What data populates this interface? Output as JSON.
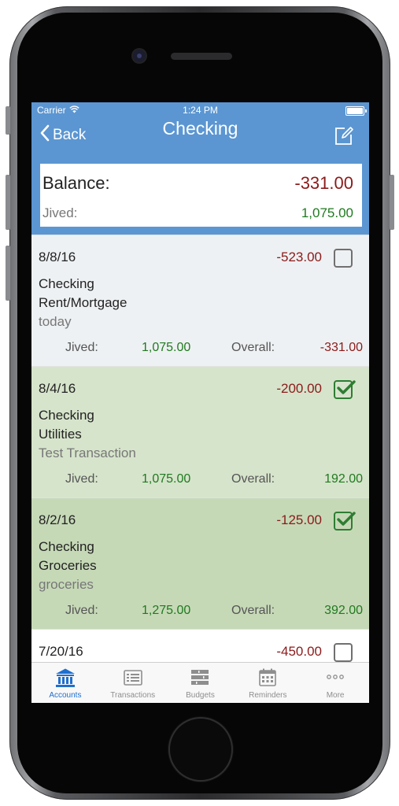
{
  "status_bar": {
    "carrier": "Carrier",
    "time": "1:24 PM"
  },
  "nav": {
    "back_label": "Back",
    "title": "Checking"
  },
  "balance": {
    "label": "Balance:",
    "value": "-331.00",
    "jived_label": "Jived:",
    "jived_value": "1,075.00"
  },
  "transactions": [
    {
      "date": "8/8/16",
      "amount": "-523.00",
      "checked": false,
      "account": "Checking",
      "category": "Rent/Mortgage",
      "memo": "today",
      "jived_label": "Jived:",
      "jived": "1,075.00",
      "overall_label": "Overall:",
      "overall": "-331.00",
      "bg": "#eef1f3",
      "overall_color": "#8b1a1a"
    },
    {
      "date": "8/4/16",
      "amount": "-200.00",
      "checked": true,
      "account": "Checking",
      "category": "Utilities",
      "memo": "Test Transaction",
      "jived_label": "Jived:",
      "jived": "1,075.00",
      "overall_label": "Overall:",
      "overall": "192.00",
      "bg": "#d6e4cb",
      "overall_color": "#1f7a1f"
    },
    {
      "date": "8/2/16",
      "amount": "-125.00",
      "checked": true,
      "account": "Checking",
      "category": "Groceries",
      "memo": "groceries",
      "jived_label": "Jived:",
      "jived": "1,275.00",
      "overall_label": "Overall:",
      "overall": "392.00",
      "bg": "#c6d9b7",
      "overall_color": "#1f7a1f"
    },
    {
      "date": "7/20/16",
      "amount": "-450.00",
      "checked": false,
      "account": "",
      "category": "",
      "memo": "",
      "jived_label": "",
      "jived": "",
      "overall_label": "",
      "overall": "",
      "bg": "#ffffff",
      "overall_color": "#8b1a1a"
    }
  ],
  "tabs": [
    {
      "label": "Accounts",
      "icon": "bank-icon",
      "active": true
    },
    {
      "label": "Transactions",
      "icon": "list-icon",
      "active": false
    },
    {
      "label": "Budgets",
      "icon": "budget-stack-icon",
      "active": false
    },
    {
      "label": "Reminders",
      "icon": "calendar-icon",
      "active": false
    },
    {
      "label": "More",
      "icon": "more-dots-icon",
      "active": false
    }
  ],
  "colors": {
    "nav_blue": "#5b96d2",
    "negative": "#8b1a1a",
    "positive": "#1f7a1f",
    "tab_active": "#1f6fcf"
  }
}
